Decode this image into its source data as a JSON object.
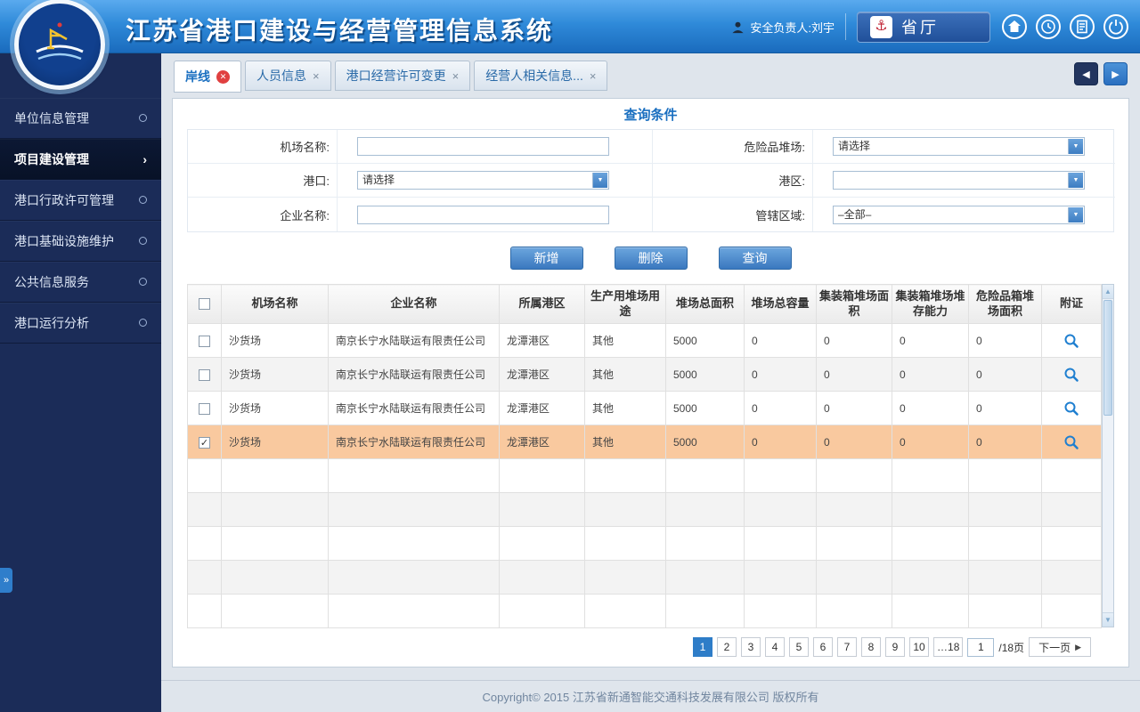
{
  "header": {
    "title": "江苏省港口建设与经营管理信息系统",
    "user_label": "安全负责人:刘宇",
    "dept_button": "省厅"
  },
  "tabs": [
    {
      "label": "岸线",
      "active": true
    },
    {
      "label": "人员信息",
      "active": false
    },
    {
      "label": "港口经营许可变更",
      "active": false
    },
    {
      "label": "经营人相关信息...",
      "active": false
    }
  ],
  "sidebar": {
    "items": [
      {
        "label": "单位信息管理",
        "active": false
      },
      {
        "label": "项目建设管理",
        "active": true
      },
      {
        "label": "港口行政许可管理",
        "active": false
      },
      {
        "label": "港口基础设施维护",
        "active": false
      },
      {
        "label": "公共信息服务",
        "active": false
      },
      {
        "label": "港口运行分析",
        "active": false
      }
    ]
  },
  "query": {
    "title": "查询条件",
    "fields": [
      {
        "label": "机场名称:",
        "type": "text",
        "value": ""
      },
      {
        "label": "危险品堆场:",
        "type": "select",
        "value": "请选择"
      },
      {
        "label": "港口:",
        "type": "select",
        "value": "请选择"
      },
      {
        "label": "港区:",
        "type": "select",
        "value": ""
      },
      {
        "label": "企业名称:",
        "type": "text",
        "value": ""
      },
      {
        "label": "管辖区域:",
        "type": "select",
        "value": "–全部–"
      }
    ],
    "buttons": {
      "add": "新增",
      "delete": "删除",
      "search": "查询"
    }
  },
  "table": {
    "headers": [
      "机场名称",
      "企业名称",
      "所属港区",
      "生产用堆场用途",
      "堆场总面积",
      "堆场总容量",
      "集装箱堆场面积",
      "集装箱堆场堆存能力",
      "危险品箱堆场面积",
      "附证"
    ],
    "rows": [
      {
        "checked": false,
        "highlighted": false,
        "cells": [
          "沙货场",
          "南京长宁水陆联运有限责任公司",
          "龙潭港区",
          "其他",
          "5000",
          "0",
          "0",
          "0",
          "0"
        ]
      },
      {
        "checked": false,
        "highlighted": false,
        "cells": [
          "沙货场",
          "南京长宁水陆联运有限责任公司",
          "龙潭港区",
          "其他",
          "5000",
          "0",
          "0",
          "0",
          "0"
        ]
      },
      {
        "checked": false,
        "highlighted": false,
        "cells": [
          "沙货场",
          "南京长宁水陆联运有限责任公司",
          "龙潭港区",
          "其他",
          "5000",
          "0",
          "0",
          "0",
          "0"
        ]
      },
      {
        "checked": true,
        "highlighted": true,
        "cells": [
          "沙货场",
          "南京长宁水陆联运有限责任公司",
          "龙潭港区",
          "其他",
          "5000",
          "0",
          "0",
          "0",
          "0"
        ]
      }
    ]
  },
  "pagination": {
    "pages": [
      "1",
      "2",
      "3",
      "4",
      "5",
      "6",
      "7",
      "8",
      "9",
      "10",
      "…18"
    ],
    "current": "1",
    "input_value": "1",
    "total_label": "/18页",
    "next_label": "下一页"
  },
  "footer": {
    "copyright": "Copyright© 2015 江苏省新通智能交通科技发展有限公司 版权所有"
  },
  "icons": {
    "tab_close_active": "✕",
    "tab_close": "×",
    "nav_back": "◀",
    "nav_forward": "▶",
    "collapse": "»",
    "check": "✓",
    "select_arrow": "▼",
    "next_arrow": "▶"
  },
  "colors": {
    "accent_blue": "#2e7dc8",
    "sidebar_navy": "#1b2c58",
    "highlight_row": "#f9c99f",
    "header_blue": "#2f8ad9"
  }
}
